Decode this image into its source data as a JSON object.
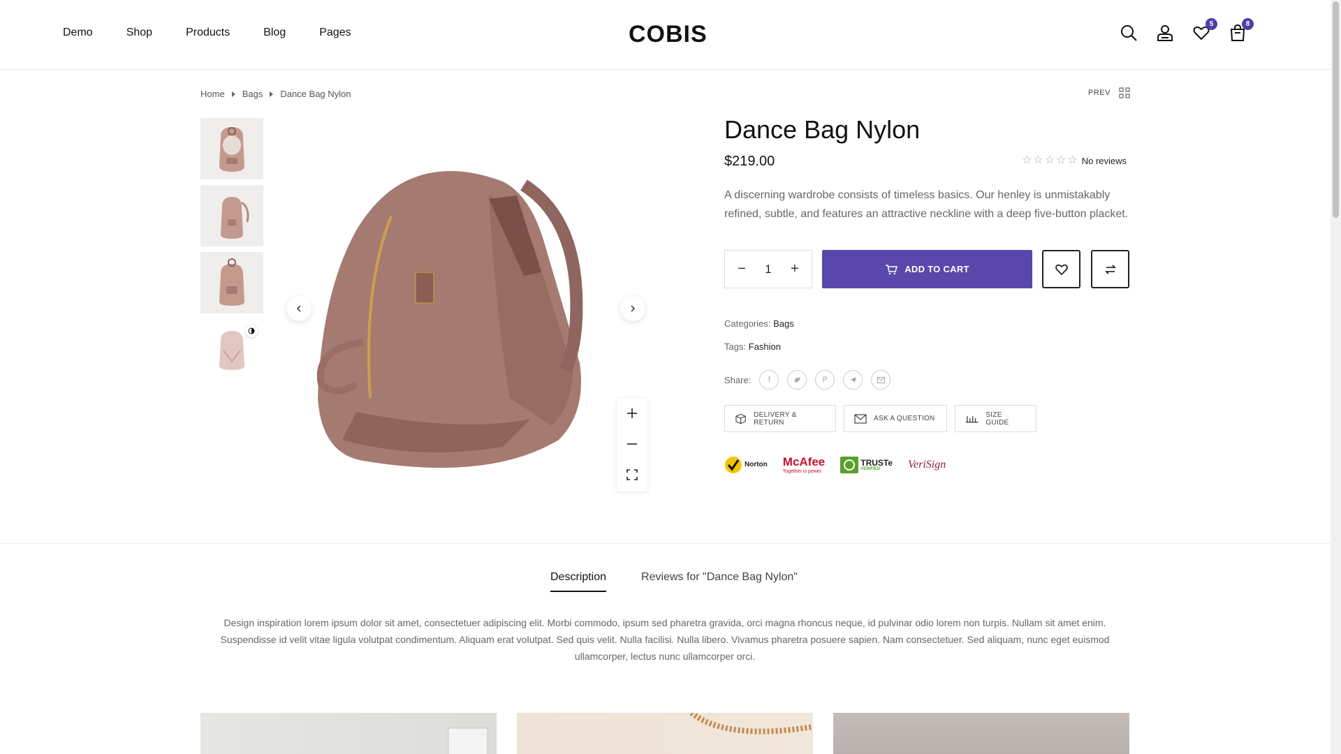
{
  "nav": {
    "items": [
      "Demo",
      "Shop",
      "Products",
      "Blog",
      "Pages"
    ]
  },
  "logo": "COBIS",
  "header_icons": {
    "wishlist_count": "5",
    "cart_count": "8"
  },
  "breadcrumb": {
    "items": [
      "Home",
      "Bags",
      "Dance Bag Nylon"
    ]
  },
  "prev_label": "PREV",
  "product": {
    "title": "Dance Bag Nylon",
    "price": "$219.00",
    "rating_label": "No reviews",
    "description": "A discerning wardrobe consists of timeless basics. Our henley is unmistakably refined, subtle, and features an attractive neckline with a deep five-button placket.",
    "quantity": "1",
    "add_to_cart": "ADD TO CART",
    "categories_label": "Categories:",
    "categories_value": "Bags",
    "tags_label": "Tags:",
    "tags_value": "Fashion",
    "share_label": "Share:"
  },
  "actions": {
    "delivery": "DELIVERY & RETURN",
    "question": "ASK A QUESTION",
    "size": "SIZE GUIDE"
  },
  "trust": {
    "norton": "Norton",
    "mcafee": "McAfee",
    "mcafee_sub": "Together is power.",
    "truste": "TRUSTe",
    "truste_sub": "VERIFIED",
    "verisign": "VeriSign"
  },
  "tabs": {
    "description": "Description",
    "reviews": "Reviews for \"Dance Bag Nylon\""
  },
  "tab_content": "Design inspiration lorem ipsum dolor sit amet, consectetuer adipiscing elit. Morbi commodo, ipsum sed pharetra gravida, orci magna rhoncus neque, id pulvinar odio lorem non turpis. Nullam sit amet enim. Suspendisse id velit vitae ligula volutpat condimentum. Aliquam erat volutpat. Sed quis velit. Nulla facilisi. Nulla libero. Vivamus pharetra posuere sapien. Nam consectetuer. Sed aliquam, nunc eget euismod ullamcorper, lectus nunc ullamcorper orci.",
  "colors": {
    "accent": "#5a47ab",
    "bag": "#b0857c"
  }
}
